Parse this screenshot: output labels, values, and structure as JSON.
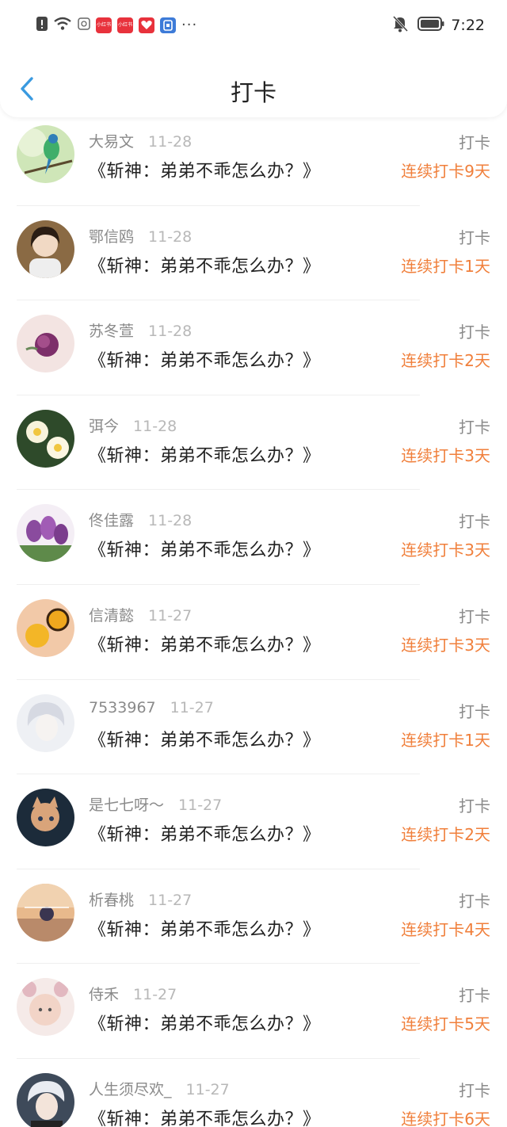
{
  "status_bar": {
    "time": "7:22",
    "notif_icons": [
      "warning-icon",
      "wifi-icon",
      "gallery-icon",
      "xiaohongshu-icon",
      "xiaohongshu-icon",
      "game-icon",
      "ticket-icon"
    ],
    "xhs_label": "小红书",
    "more": "···"
  },
  "header": {
    "title": "打卡"
  },
  "colors": {
    "accent_blue": "#3a9ae0",
    "streak_orange": "#f07f3b",
    "muted_gray": "#8a8a8a"
  },
  "checkins": [
    {
      "name": "大易文",
      "date": "11-28",
      "book": "《斩神：弟弟不乖怎么办？》",
      "action": "打卡",
      "streak": "连续打卡9天"
    },
    {
      "name": "鄂信鸥",
      "date": "11-28",
      "book": "《斩神：弟弟不乖怎么办？》",
      "action": "打卡",
      "streak": "连续打卡1天"
    },
    {
      "name": "苏冬萱",
      "date": "11-28",
      "book": "《斩神：弟弟不乖怎么办？》",
      "action": "打卡",
      "streak": "连续打卡2天"
    },
    {
      "name": "弭今",
      "date": "11-28",
      "book": "《斩神：弟弟不乖怎么办？》",
      "action": "打卡",
      "streak": "连续打卡3天"
    },
    {
      "name": "佟佳露",
      "date": "11-28",
      "book": "《斩神：弟弟不乖怎么办？》",
      "action": "打卡",
      "streak": "连续打卡3天"
    },
    {
      "name": "信清懿",
      "date": "11-27",
      "book": "《斩神：弟弟不乖怎么办？》",
      "action": "打卡",
      "streak": "连续打卡3天"
    },
    {
      "name": "7533967",
      "date": "11-27",
      "book": "《斩神：弟弟不乖怎么办？》",
      "action": "打卡",
      "streak": "连续打卡1天"
    },
    {
      "name": "是七七呀～",
      "date": "11-27",
      "book": "《斩神：弟弟不乖怎么办？》",
      "action": "打卡",
      "streak": "连续打卡2天"
    },
    {
      "name": "析春桃",
      "date": "11-27",
      "book": "《斩神：弟弟不乖怎么办？》",
      "action": "打卡",
      "streak": "连续打卡4天"
    },
    {
      "name": "侍禾",
      "date": "11-27",
      "book": "《斩神：弟弟不乖怎么办？》",
      "action": "打卡",
      "streak": "连续打卡5天"
    },
    {
      "name": "人生须尽欢_",
      "date": "11-27",
      "book": "《斩神：弟弟不乖怎么办？》",
      "action": "打卡",
      "streak": "连续打卡6天"
    }
  ]
}
